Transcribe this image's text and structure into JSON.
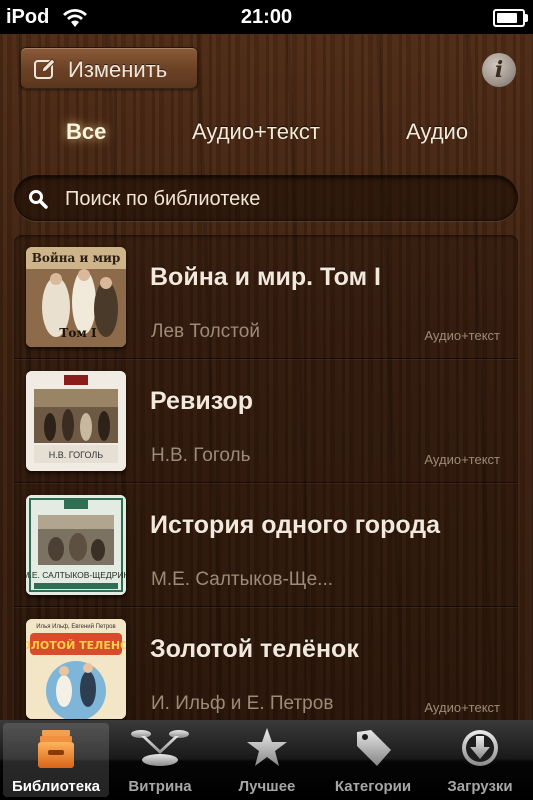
{
  "status": {
    "carrier": "iPod",
    "time": "21:00",
    "battery_level": 0.85
  },
  "header": {
    "edit_label": "Изменить",
    "info_label": "i"
  },
  "filters": [
    {
      "label": "Все",
      "selected": true
    },
    {
      "label": "Аудио+текст",
      "selected": false
    },
    {
      "label": "Аудио",
      "selected": false
    }
  ],
  "search": {
    "placeholder": "Поиск по библиотеке",
    "value": ""
  },
  "books": [
    {
      "title": "Война и мир. Том I",
      "author": "Лев Толстой",
      "format": "Аудио+текст",
      "cover_text": "Война и мир",
      "cover_sub": "Том I"
    },
    {
      "title": "Ревизор",
      "author": "Н.В. Гоголь",
      "format": "Аудио+текст",
      "cover_text": "Н.В. ГОГОЛЬ",
      "cover_sub": ""
    },
    {
      "title": "История одного города",
      "author": "М.Е. Салтыков-Ще...",
      "format": "",
      "cover_text": "М.Е. САЛТЫКОВ-ЩЕДРИН",
      "cover_sub": ""
    },
    {
      "title": "Золотой телёнок",
      "author": "И. Ильф и Е. Петров",
      "format": "Аудио+текст",
      "cover_text": "ЗОЛОТОЙ ТЕЛЕНОК",
      "cover_sub": "Илья Ильф, Евгений Петров"
    }
  ],
  "tabs": [
    {
      "label": "Библиотека",
      "icon": "library-icon",
      "active": true
    },
    {
      "label": "Витрина",
      "icon": "showcase-icon",
      "active": false
    },
    {
      "label": "Лучшее",
      "icon": "star-icon",
      "active": false
    },
    {
      "label": "Категории",
      "icon": "tag-icon",
      "active": false
    },
    {
      "label": "Загрузки",
      "icon": "download-icon",
      "active": false
    }
  ],
  "colors": {
    "wood": "#3e2110",
    "accent_tab": "#e8802a",
    "text_light": "#f2e8dc",
    "text_muted": "#9e8a78"
  }
}
